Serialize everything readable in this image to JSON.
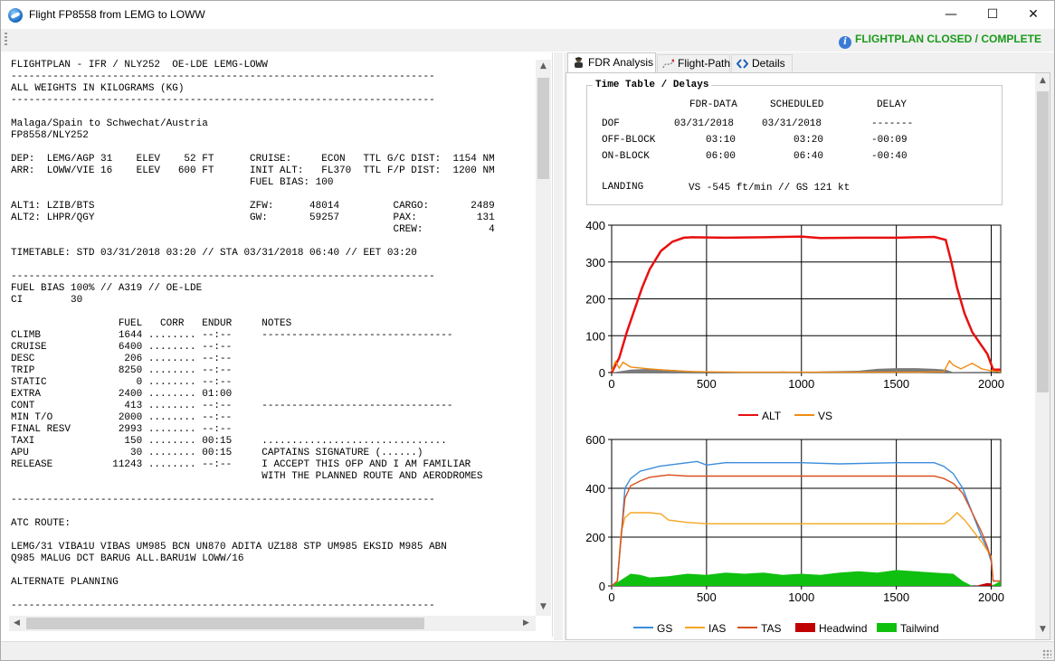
{
  "window": {
    "title": "Flight FP8558 from LEMG to LOWW",
    "minimize": "—",
    "maximize": "☐",
    "close": "✕"
  },
  "status": {
    "icon": "info-icon",
    "text": "FLIGHTPLAN CLOSED / COMPLETE",
    "color": "#1a9a1a"
  },
  "flightplan_text": "FLIGHTPLAN - IFR / NLY252  OE-LDE LEMG-LOWW\n-----------------------------------------------------------------------\nALL WEIGHTS IN KILOGRAMS (KG)\n-----------------------------------------------------------------------\n\nMalaga/Spain to Schwechat/Austria\nFP8558/NLY252\n\nDEP:  LEMG/AGP 31    ELEV    52 FT      CRUISE:     ECON   TTL G/C DIST:  1154 NM\nARR:  LOWW/VIE 16    ELEV   600 FT      INIT ALT:   FL370  TTL F/P DIST:  1200 NM\n                                        FUEL BIAS: 100\n\nALT1: LZIB/BTS                          ZFW:      48014         CARGO:       2489\nALT2: LHPR/QGY                          GW:       59257         PAX:          131\n                                                                CREW:           4\n\nTIMETABLE: STD 03/31/2018 03:20 // STA 03/31/2018 06:40 // EET 03:20\n\n-----------------------------------------------------------------------\nFUEL BIAS 100% // A319 // OE-LDE\nCI        30\n\n                  FUEL   CORR   ENDUR     NOTES\nCLIMB             1644 ........ --:--     --------------------------------\nCRUISE            6400 ........ --:--\nDESC               206 ........ --:--\nTRIP              8250 ........ --:--\nSTATIC               0 ........ --:--\nEXTRA             2400 ........ 01:00\nCONT               413 ........ --:--     --------------------------------\nMIN T/O           2000 ........ --:--\nFINAL RESV        2993 ........ --:--\nTAXI               150 ........ 00:15     ...............................\nAPU                 30 ........ 00:15     CAPTAINS SIGNATURE (......)\nRELEASE          11243 ........ --:--     I ACCEPT THIS OFP AND I AM FAMILIAR\n                                          WITH THE PLANNED ROUTE AND AERODROMES\n\n-----------------------------------------------------------------------\n\nATC ROUTE:\n\nLEMG/31 VIBA1U VIBAS UM985 BCN UN870 ADITA UZ188 STP UM985 EKSID M985 ABN\nQ985 MALUG DCT BARUG ALL.BARU1W LOWW/16\n\nALTERNATE PLANNING\n\n-----------------------------------------------------------------------",
  "tabs": [
    {
      "label": "FDR Analysis",
      "icon": "pilot-icon",
      "active": true
    },
    {
      "label": "Flight-Path",
      "icon": "route-icon",
      "active": false
    },
    {
      "label": "Details",
      "icon": "code-icon",
      "active": false
    }
  ],
  "timetable": {
    "legend": "Time Table / Delays",
    "headers": [
      "FDR-DATA",
      "SCHEDULED",
      "DELAY"
    ],
    "rows": [
      {
        "label": "DOF",
        "fdr": "03/31/2018",
        "scheduled": "03/31/2018",
        "delay": "-------"
      },
      {
        "label": "OFF-BLOCK",
        "fdr": "03:10",
        "scheduled": "03:20",
        "delay": "-00:09"
      },
      {
        "label": "ON-BLOCK",
        "fdr": "06:00",
        "scheduled": "06:40",
        "delay": "-00:40"
      }
    ],
    "landing_label": "LANDING",
    "landing_value": "VS -545 ft/min // GS 121 kt"
  },
  "chart_data": [
    {
      "type": "line",
      "xlim": [
        0,
        2050
      ],
      "ylim": [
        0,
        400
      ],
      "x_ticks": [
        "0",
        "500",
        "1000",
        "1500",
        "2000"
      ],
      "y_ticks": [
        "0",
        "100",
        "200",
        "300",
        "400"
      ],
      "grid": true,
      "legend": "bottom",
      "series": [
        {
          "name": "ALT",
          "color": "#e81010",
          "x": [
            0,
            40,
            80,
            120,
            160,
            200,
            260,
            320,
            380,
            420,
            600,
            800,
            1000,
            1100,
            1300,
            1500,
            1600,
            1700,
            1760,
            1790,
            1820,
            1860,
            1900,
            1940,
            1980,
            2010,
            2050
          ],
          "values": [
            0,
            40,
            110,
            170,
            230,
            280,
            330,
            355,
            366,
            367,
            366,
            367,
            369,
            365,
            366,
            366,
            367,
            368,
            360,
            300,
            230,
            160,
            110,
            80,
            50,
            8,
            8
          ]
        },
        {
          "name": "VS",
          "color": "#f08c14",
          "x": [
            0,
            20,
            40,
            60,
            100,
            200,
            300,
            400,
            500,
            700,
            1000,
            1300,
            1600,
            1750,
            1780,
            1800,
            1840,
            1900,
            1950,
            2000,
            2050
          ],
          "values": [
            5,
            30,
            12,
            28,
            15,
            10,
            6,
            3,
            2,
            1,
            1,
            1,
            1,
            2,
            32,
            20,
            10,
            25,
            10,
            5,
            2
          ]
        },
        {
          "name": "",
          "color": "#7a7a7a",
          "area": true,
          "x": [
            0,
            100,
            200,
            300,
            400,
            500,
            600,
            700,
            800,
            900,
            1000,
            1100,
            1200,
            1300,
            1400,
            1500,
            1600,
            1700,
            1760,
            1800,
            2050
          ],
          "values": [
            0,
            8,
            10,
            8,
            5,
            1,
            1,
            2,
            1,
            3,
            1,
            3,
            4,
            5,
            10,
            12,
            12,
            10,
            8,
            1,
            0
          ]
        }
      ]
    },
    {
      "type": "line",
      "xlim": [
        0,
        2050
      ],
      "ylim": [
        0,
        600
      ],
      "x_ticks": [
        "0",
        "500",
        "1000",
        "1500",
        "2000"
      ],
      "y_ticks": [
        "0",
        "200",
        "400",
        "600"
      ],
      "grid": true,
      "legend": "bottom",
      "series": [
        {
          "name": "GS",
          "color": "#3c8ddc",
          "x": [
            0,
            30,
            50,
            70,
            100,
            150,
            200,
            250,
            300,
            400,
            450,
            500,
            600,
            800,
            1000,
            1200,
            1500,
            1700,
            1750,
            1800,
            1850,
            1900,
            1950,
            1980,
            2000,
            2010,
            2050
          ],
          "values": [
            0,
            20,
            200,
            400,
            440,
            470,
            480,
            490,
            495,
            505,
            510,
            495,
            505,
            505,
            505,
            500,
            505,
            505,
            490,
            460,
            400,
            300,
            200,
            150,
            100,
            20,
            20
          ]
        },
        {
          "name": "IAS",
          "color": "#f5a623",
          "x": [
            0,
            30,
            50,
            70,
            100,
            200,
            260,
            300,
            400,
            500,
            700,
            1000,
            1300,
            1600,
            1750,
            1780,
            1820,
            1860,
            1900,
            1950,
            2000,
            2010,
            2050
          ],
          "values": [
            0,
            20,
            220,
            280,
            300,
            300,
            295,
            270,
            260,
            255,
            255,
            255,
            255,
            255,
            255,
            270,
            300,
            270,
            230,
            180,
            120,
            20,
            20
          ]
        },
        {
          "name": "TAS",
          "color": "#d9501e",
          "x": [
            0,
            30,
            50,
            70,
            100,
            150,
            200,
            250,
            300,
            400,
            500,
            800,
            1000,
            1200,
            1500,
            1700,
            1750,
            1800,
            1850,
            1900,
            1950,
            1980,
            2000,
            2010,
            2050
          ],
          "values": [
            0,
            20,
            200,
            360,
            410,
            430,
            445,
            450,
            455,
            450,
            450,
            450,
            450,
            450,
            450,
            450,
            440,
            420,
            380,
            300,
            220,
            160,
            110,
            20,
            20
          ]
        },
        {
          "name": "Headwind",
          "color": "#c00000",
          "area": true,
          "x": [
            0,
            1920,
            1940,
            1980,
            2000,
            2010,
            2050
          ],
          "values": [
            0,
            0,
            5,
            12,
            10,
            0,
            0
          ]
        },
        {
          "name": "Tailwind",
          "color": "#10c010",
          "area": true,
          "x": [
            0,
            80,
            100,
            150,
            200,
            300,
            400,
            500,
            600,
            700,
            800,
            900,
            1000,
            1100,
            1200,
            1300,
            1400,
            1500,
            1600,
            1700,
            1800,
            1850,
            1900,
            2000,
            2050
          ],
          "values": [
            0,
            40,
            50,
            45,
            35,
            40,
            50,
            45,
            55,
            50,
            55,
            45,
            50,
            45,
            55,
            60,
            55,
            65,
            60,
            55,
            50,
            20,
            0,
            0,
            20
          ]
        }
      ]
    }
  ]
}
